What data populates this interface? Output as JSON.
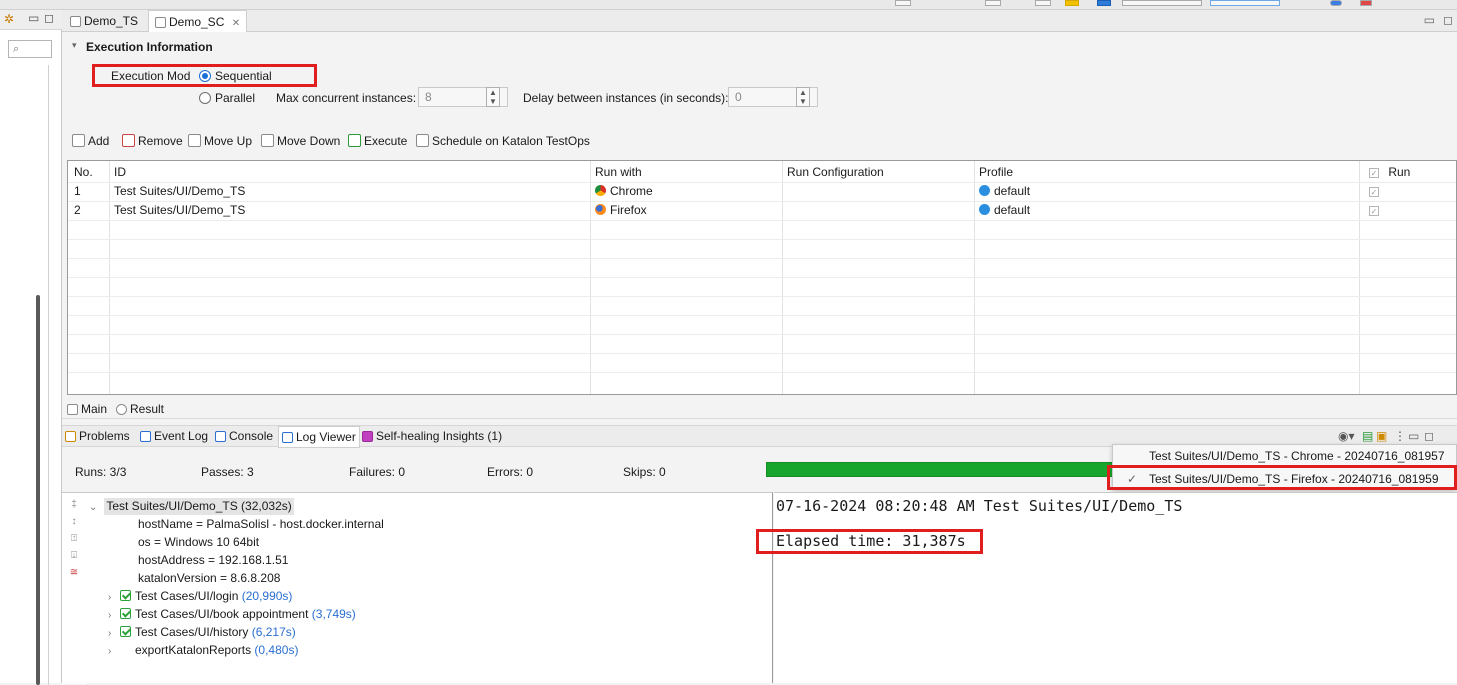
{
  "editor_tabs": [
    {
      "label": "Demo_TS"
    },
    {
      "label": "Demo_SC",
      "close": "✕"
    }
  ],
  "left": {
    "search_icon": "search-icon"
  },
  "execution": {
    "section_title": "Execution Information",
    "mode_label": "Execution Mod",
    "sequential_label": "Sequential",
    "parallel_label": "Parallel",
    "max_instances_label": "Max concurrent instances:",
    "max_instances_value": "8",
    "delay_label": "Delay between instances (in seconds):",
    "delay_value": "0"
  },
  "actions": [
    "Add",
    "Remove",
    "Move Up",
    "Move Down",
    "Execute",
    "Schedule on Katalon TestOps"
  ],
  "table": {
    "headers": [
      "No.",
      "ID",
      "Run with",
      "Run Configuration",
      "Profile",
      "Run"
    ],
    "rows": [
      {
        "no": "1",
        "id": "Test Suites/UI/Demo_TS",
        "run_with": "Chrome",
        "profile": "default"
      },
      {
        "no": "2",
        "id": "Test Suites/UI/Demo_TS",
        "run_with": "Firefox",
        "profile": "default"
      }
    ]
  },
  "sub_tabs": [
    "Main",
    "Result"
  ],
  "view_tabs": [
    "Problems",
    "Event Log",
    "Console",
    "Log Viewer",
    "Self-healing Insights (1)"
  ],
  "stats": {
    "runs": "Runs: 3/3",
    "passes": "Passes: 3",
    "failures": "Failures: 0",
    "errors": "Errors: 0",
    "skips": "Skips: 0",
    "progress_fraction": 1.0
  },
  "dropdown": {
    "items": [
      {
        "label": "Test Suites/UI/Demo_TS - Chrome - 20240716_081957",
        "checked": false
      },
      {
        "label": "Test Suites/UI/Demo_TS - Firefox - 20240716_081959",
        "checked": true
      }
    ]
  },
  "tree": {
    "root_label": "Test Suites/UI/Demo_TS (32,032s)",
    "props": [
      "hostName = PalmaSolisl - host.docker.internal",
      "os = Windows 10 64bit",
      "hostAddress = 192.168.1.51",
      "katalonVersion = 8.6.8.208"
    ],
    "cases": [
      {
        "name": "Test Cases/UI/login",
        "duration": "(20,990s)",
        "pass": true
      },
      {
        "name": "Test Cases/UI/book appointment",
        "duration": "(3,749s)",
        "pass": true
      },
      {
        "name": "Test Cases/UI/history",
        "duration": "(6,217s)",
        "pass": true
      },
      {
        "name": "exportKatalonReports",
        "duration": "(0,480s)",
        "pass": false
      }
    ]
  },
  "log": {
    "line1": "07-16-2024 08:20:48 AM Test Suites/UI/Demo_TS",
    "line2": "Elapsed time: 31,387s"
  },
  "colors": {
    "highlight": "#e01e1e",
    "progress": "#18a52e",
    "accent": "#1a6ed8"
  }
}
